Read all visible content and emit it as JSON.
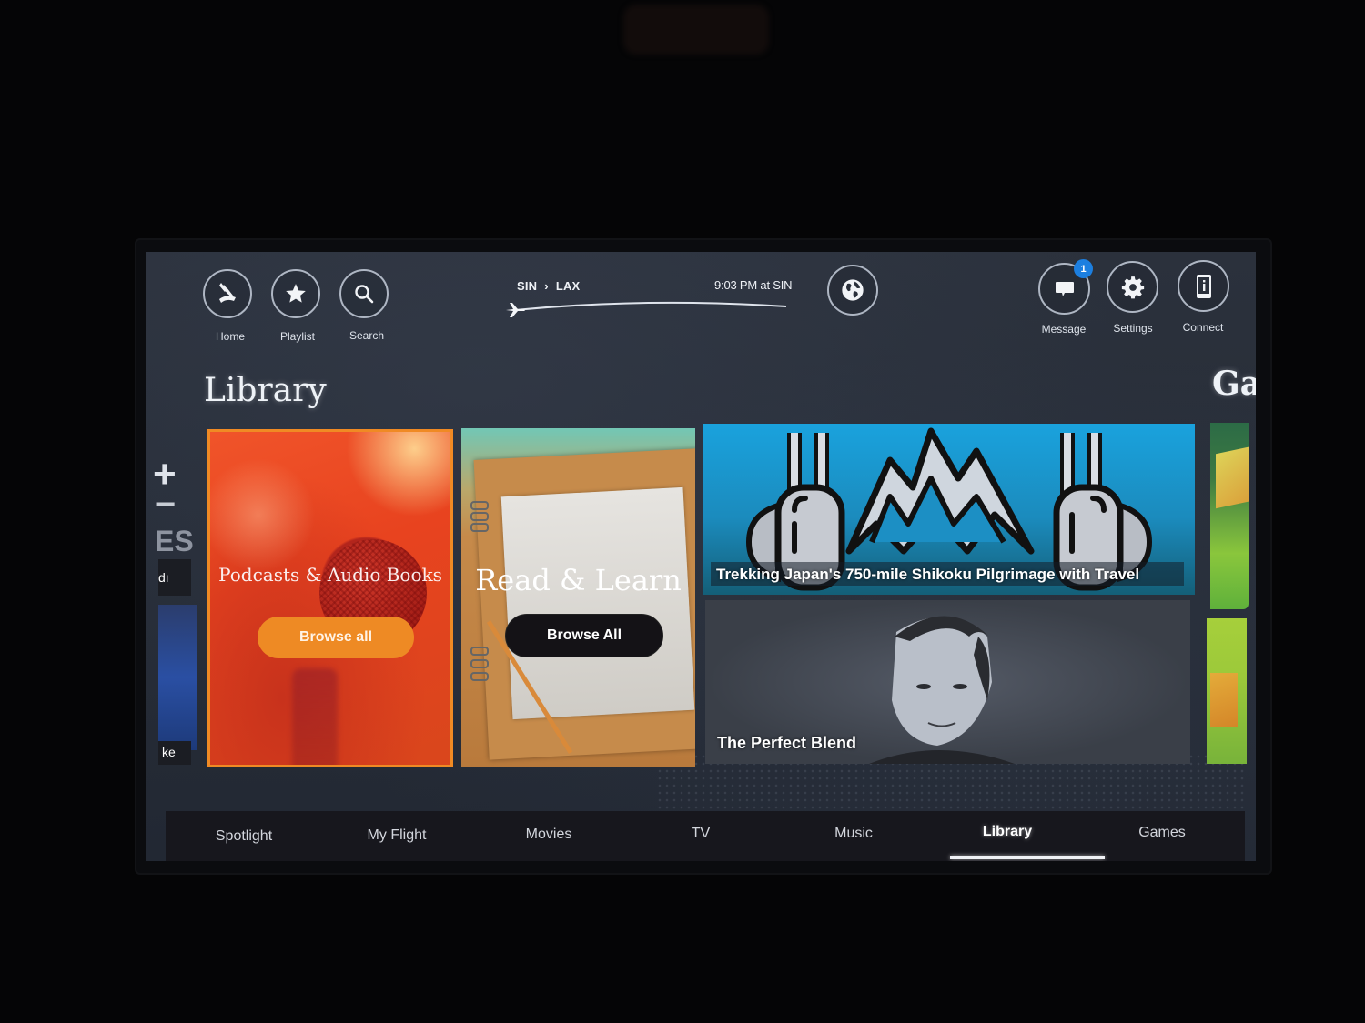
{
  "header": {
    "left_buttons": [
      {
        "label": "Home",
        "icon": "airline-logo-icon"
      },
      {
        "label": "Playlist",
        "icon": "star-icon"
      },
      {
        "label": "Search",
        "icon": "search-icon"
      }
    ],
    "flight": {
      "origin": "SIN",
      "destination": "LAX",
      "separator": "›",
      "local_time": "9:03 PM at SIN",
      "progress": 0.02
    },
    "globe_button": {
      "icon": "globe-icon"
    },
    "right_buttons": [
      {
        "label": "Message",
        "icon": "message-icon",
        "badge": "1"
      },
      {
        "label": "Settings",
        "icon": "gear-icon"
      },
      {
        "label": "Connect",
        "icon": "phone-info-icon"
      }
    ]
  },
  "main": {
    "section_title": "Library",
    "next_section_peek": "Ga",
    "prev_section_peek": {
      "symbols": [
        "+",
        "−"
      ],
      "text": "ES",
      "items": [
        "dı",
        "ke"
      ]
    },
    "tiles": [
      {
        "title": "Podcasts & Audio Books",
        "button": "Browse all",
        "selected": true
      },
      {
        "title": "Read & Learn",
        "button": "Browse All"
      },
      {
        "caption": "Trekking Japan's 750-mile Shikoku Pilgrimage with Travel"
      },
      {
        "caption": "The Perfect Blend"
      },
      {
        "caption": ""
      },
      {
        "caption": ""
      }
    ],
    "accent_color": "#ee8a24"
  },
  "tabbar": {
    "tabs": [
      {
        "label": "Spotlight"
      },
      {
        "label": "My Flight"
      },
      {
        "label": "Movies"
      },
      {
        "label": "TV"
      },
      {
        "label": "Music"
      },
      {
        "label": "Library",
        "active": true
      },
      {
        "label": "Games"
      }
    ]
  }
}
